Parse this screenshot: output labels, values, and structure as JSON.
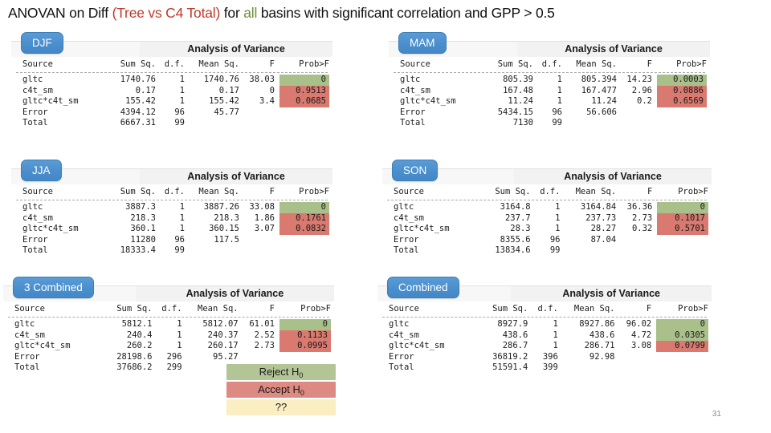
{
  "slide": {
    "title_parts": [
      {
        "text": "ANOVAN on Diff ",
        "color": "black"
      },
      {
        "text": "(Tree vs C4 Total)",
        "color": "red"
      },
      {
        "text": " for ",
        "color": "black"
      },
      {
        "text": "all",
        "color": "green"
      },
      {
        "text": " basins with significant correlation and GPP > 0.5",
        "color": "black"
      }
    ],
    "title_plain": "ANOVAN on Diff (Tree vs C4 Total) for all basins with significant correlation and GPP > 0.5",
    "number": "31"
  },
  "colors": {
    "tab_blue": "#4a8fcd",
    "highlight_green": "#a9c08b",
    "highlight_red": "#d9796f",
    "legend_green": "#b3c596",
    "legend_red": "#dc8a82",
    "legend_yellow": "#fbeec2",
    "title_red": "#c0392b",
    "title_green": "#6a8f3a"
  },
  "table_heading": "Analysis of Variance",
  "columns": [
    "Source",
    "Sum Sq.",
    "d.f.",
    "Mean Sq.",
    "F",
    "Prob>F"
  ],
  "panels": [
    {
      "id": "djf",
      "tab_label": "DJF",
      "heading": "Analysis of Variance",
      "rows": [
        {
          "source": "gltc",
          "sum_sq": "1740.76",
          "df": "1",
          "mean_sq": "1740.76",
          "f": "38.03",
          "prob": "0",
          "hl": "green"
        },
        {
          "source": "c4t_sm",
          "sum_sq": "0.17",
          "df": "1",
          "mean_sq": "0.17",
          "f": "0",
          "prob": "0.9513",
          "hl": "red"
        },
        {
          "source": "gltc*c4t_sm",
          "sum_sq": "155.42",
          "df": "1",
          "mean_sq": "155.42",
          "f": "3.4",
          "prob": "0.0685",
          "hl": "red"
        },
        {
          "source": "Error",
          "sum_sq": "4394.12",
          "df": "96",
          "mean_sq": "45.77",
          "f": "",
          "prob": "",
          "hl": "none"
        },
        {
          "source": "Total",
          "sum_sq": "6667.31",
          "df": "99",
          "mean_sq": "",
          "f": "",
          "prob": "",
          "hl": "none"
        }
      ]
    },
    {
      "id": "mam",
      "tab_label": "MAM",
      "heading": "Analysis of Variance",
      "rows": [
        {
          "source": "gltc",
          "sum_sq": "805.39",
          "df": "1",
          "mean_sq": "805.394",
          "f": "14.23",
          "prob": "0.0003",
          "hl": "green"
        },
        {
          "source": "c4t_sm",
          "sum_sq": "167.48",
          "df": "1",
          "mean_sq": "167.477",
          "f": "2.96",
          "prob": "0.0886",
          "hl": "red"
        },
        {
          "source": "gltc*c4t_sm",
          "sum_sq": "11.24",
          "df": "1",
          "mean_sq": "11.24",
          "f": "0.2",
          "prob": "0.6569",
          "hl": "red"
        },
        {
          "source": "Error",
          "sum_sq": "5434.15",
          "df": "96",
          "mean_sq": "56.606",
          "f": "",
          "prob": "",
          "hl": "none"
        },
        {
          "source": "Total",
          "sum_sq": "7130",
          "df": "99",
          "mean_sq": "",
          "f": "",
          "prob": "",
          "hl": "none"
        }
      ]
    },
    {
      "id": "jja",
      "tab_label": "JJA",
      "heading": "Analysis of Variance",
      "rows": [
        {
          "source": "gltc",
          "sum_sq": "3887.3",
          "df": "1",
          "mean_sq": "3887.26",
          "f": "33.08",
          "prob": "0",
          "hl": "green"
        },
        {
          "source": "c4t_sm",
          "sum_sq": "218.3",
          "df": "1",
          "mean_sq": "218.3",
          "f": "1.86",
          "prob": "0.1761",
          "hl": "red"
        },
        {
          "source": "gltc*c4t_sm",
          "sum_sq": "360.1",
          "df": "1",
          "mean_sq": "360.15",
          "f": "3.07",
          "prob": "0.0832",
          "hl": "red"
        },
        {
          "source": "Error",
          "sum_sq": "11280",
          "df": "96",
          "mean_sq": "117.5",
          "f": "",
          "prob": "",
          "hl": "none"
        },
        {
          "source": "Total",
          "sum_sq": "18333.4",
          "df": "99",
          "mean_sq": "",
          "f": "",
          "prob": "",
          "hl": "none"
        }
      ]
    },
    {
      "id": "son",
      "tab_label": "SON",
      "heading": "Analysis of Variance",
      "rows": [
        {
          "source": "gltc",
          "sum_sq": "3164.8",
          "df": "1",
          "mean_sq": "3164.84",
          "f": "36.36",
          "prob": "0",
          "hl": "green"
        },
        {
          "source": "c4t_sm",
          "sum_sq": "237.7",
          "df": "1",
          "mean_sq": "237.73",
          "f": "2.73",
          "prob": "0.1017",
          "hl": "red"
        },
        {
          "source": "gltc*c4t_sm",
          "sum_sq": "28.3",
          "df": "1",
          "mean_sq": "28.27",
          "f": "0.32",
          "prob": "0.5701",
          "hl": "red"
        },
        {
          "source": "Error",
          "sum_sq": "8355.6",
          "df": "96",
          "mean_sq": "87.04",
          "f": "",
          "prob": "",
          "hl": "none"
        },
        {
          "source": "Total",
          "sum_sq": "13834.6",
          "df": "99",
          "mean_sq": "",
          "f": "",
          "prob": "",
          "hl": "none"
        }
      ]
    },
    {
      "id": "three-combined",
      "tab_label": "3 Combined",
      "heading": "Analysis of Variance",
      "rows": [
        {
          "source": "gltc",
          "sum_sq": "5812.1",
          "df": "1",
          "mean_sq": "5812.07",
          "f": "61.01",
          "prob": "0",
          "hl": "green"
        },
        {
          "source": "c4t_sm",
          "sum_sq": "240.4",
          "df": "1",
          "mean_sq": "240.37",
          "f": "2.52",
          "prob": "0.1133",
          "hl": "red"
        },
        {
          "source": "gltc*c4t_sm",
          "sum_sq": "260.2",
          "df": "1",
          "mean_sq": "260.17",
          "f": "2.73",
          "prob": "0.0995",
          "hl": "red"
        },
        {
          "source": "Error",
          "sum_sq": "28198.6",
          "df": "296",
          "mean_sq": "95.27",
          "f": "",
          "prob": "",
          "hl": "none"
        },
        {
          "source": "Total",
          "sum_sq": "37686.2",
          "df": "299",
          "mean_sq": "",
          "f": "",
          "prob": "",
          "hl": "none"
        }
      ]
    },
    {
      "id": "combined",
      "tab_label": "Combined",
      "heading": "Analysis of Variance",
      "rows": [
        {
          "source": "gltc",
          "sum_sq": "8927.9",
          "df": "1",
          "mean_sq": "8927.86",
          "f": "96.02",
          "prob": "0",
          "hl": "green"
        },
        {
          "source": "c4t_sm",
          "sum_sq": "438.6",
          "df": "1",
          "mean_sq": "438.6",
          "f": "4.72",
          "prob": "0.0305",
          "hl": "green"
        },
        {
          "source": "gltc*c4t_sm",
          "sum_sq": "286.7",
          "df": "1",
          "mean_sq": "286.71",
          "f": "3.08",
          "prob": "0.0799",
          "hl": "red"
        },
        {
          "source": "Error",
          "sum_sq": "36819.2",
          "df": "396",
          "mean_sq": "92.98",
          "f": "",
          "prob": "",
          "hl": "none"
        },
        {
          "source": "Total",
          "sum_sq": "51591.4",
          "df": "399",
          "mean_sq": "",
          "f": "",
          "prob": "",
          "hl": "none"
        }
      ]
    }
  ],
  "legend": [
    {
      "label": "Reject H",
      "sub": "0",
      "style": "lg-green"
    },
    {
      "label": "Accept H",
      "sub": "0",
      "style": "lg-red"
    },
    {
      "label": "??",
      "sub": "",
      "style": "lg-yellow"
    }
  ]
}
